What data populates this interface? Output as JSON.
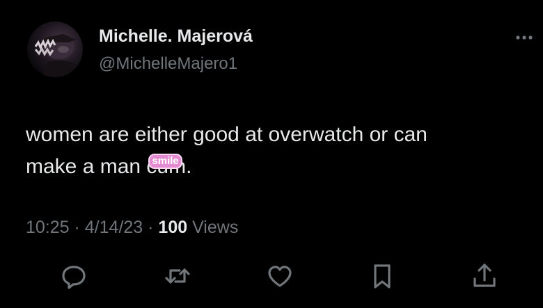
{
  "author": {
    "display_name": "Michelle. Majerová",
    "handle": "@MichelleMajero1"
  },
  "tweet": {
    "text_line_1": "women are either good at overwatch or can",
    "text_line_2_prefix": "make a man ",
    "text_line_2_hidden": "cum",
    "text_line_2_suffix": ".",
    "sticker_label": "smile"
  },
  "meta": {
    "time": "10:25",
    "separator_1": " · ",
    "date": "4/14/23",
    "separator_2": " · ",
    "views_count": "100",
    "views_label": " Views"
  },
  "actions": [
    {
      "icon": "reply-icon"
    },
    {
      "icon": "retweet-icon"
    },
    {
      "icon": "like-icon"
    },
    {
      "icon": "bookmark-icon"
    },
    {
      "icon": "share-icon"
    }
  ],
  "colors": {
    "background": "#000000",
    "primary_text": "#e7e9ea",
    "secondary_text": "#71767b",
    "sticker": "#e58bd1"
  }
}
